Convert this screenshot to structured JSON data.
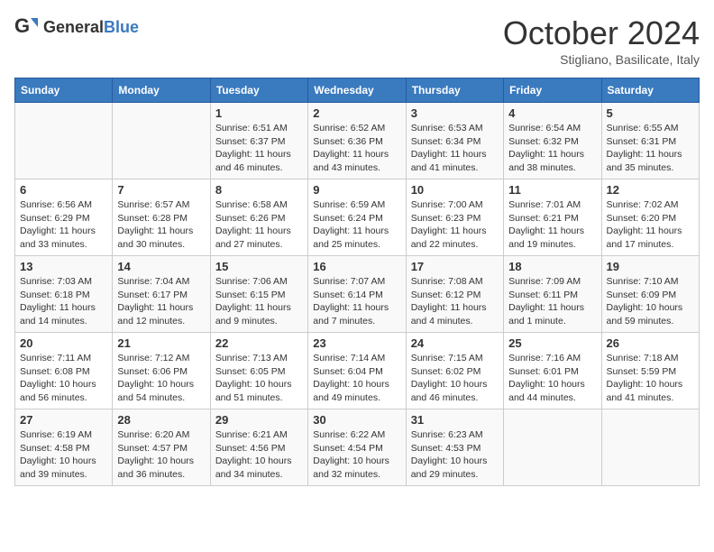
{
  "header": {
    "logo_general": "General",
    "logo_blue": "Blue",
    "month_title": "October 2024",
    "subtitle": "Stigliano, Basilicate, Italy"
  },
  "weekdays": [
    "Sunday",
    "Monday",
    "Tuesday",
    "Wednesday",
    "Thursday",
    "Friday",
    "Saturday"
  ],
  "weeks": [
    [
      null,
      null,
      {
        "day": 1,
        "sunrise": "6:51 AM",
        "sunset": "6:37 PM",
        "daylight": "11 hours and 46 minutes."
      },
      {
        "day": 2,
        "sunrise": "6:52 AM",
        "sunset": "6:36 PM",
        "daylight": "11 hours and 43 minutes."
      },
      {
        "day": 3,
        "sunrise": "6:53 AM",
        "sunset": "6:34 PM",
        "daylight": "11 hours and 41 minutes."
      },
      {
        "day": 4,
        "sunrise": "6:54 AM",
        "sunset": "6:32 PM",
        "daylight": "11 hours and 38 minutes."
      },
      {
        "day": 5,
        "sunrise": "6:55 AM",
        "sunset": "6:31 PM",
        "daylight": "11 hours and 35 minutes."
      }
    ],
    [
      {
        "day": 6,
        "sunrise": "6:56 AM",
        "sunset": "6:29 PM",
        "daylight": "11 hours and 33 minutes."
      },
      {
        "day": 7,
        "sunrise": "6:57 AM",
        "sunset": "6:28 PM",
        "daylight": "11 hours and 30 minutes."
      },
      {
        "day": 8,
        "sunrise": "6:58 AM",
        "sunset": "6:26 PM",
        "daylight": "11 hours and 27 minutes."
      },
      {
        "day": 9,
        "sunrise": "6:59 AM",
        "sunset": "6:24 PM",
        "daylight": "11 hours and 25 minutes."
      },
      {
        "day": 10,
        "sunrise": "7:00 AM",
        "sunset": "6:23 PM",
        "daylight": "11 hours and 22 minutes."
      },
      {
        "day": 11,
        "sunrise": "7:01 AM",
        "sunset": "6:21 PM",
        "daylight": "11 hours and 19 minutes."
      },
      {
        "day": 12,
        "sunrise": "7:02 AM",
        "sunset": "6:20 PM",
        "daylight": "11 hours and 17 minutes."
      }
    ],
    [
      {
        "day": 13,
        "sunrise": "7:03 AM",
        "sunset": "6:18 PM",
        "daylight": "11 hours and 14 minutes."
      },
      {
        "day": 14,
        "sunrise": "7:04 AM",
        "sunset": "6:17 PM",
        "daylight": "11 hours and 12 minutes."
      },
      {
        "day": 15,
        "sunrise": "7:06 AM",
        "sunset": "6:15 PM",
        "daylight": "11 hours and 9 minutes."
      },
      {
        "day": 16,
        "sunrise": "7:07 AM",
        "sunset": "6:14 PM",
        "daylight": "11 hours and 7 minutes."
      },
      {
        "day": 17,
        "sunrise": "7:08 AM",
        "sunset": "6:12 PM",
        "daylight": "11 hours and 4 minutes."
      },
      {
        "day": 18,
        "sunrise": "7:09 AM",
        "sunset": "6:11 PM",
        "daylight": "11 hours and 1 minute."
      },
      {
        "day": 19,
        "sunrise": "7:10 AM",
        "sunset": "6:09 PM",
        "daylight": "10 hours and 59 minutes."
      }
    ],
    [
      {
        "day": 20,
        "sunrise": "7:11 AM",
        "sunset": "6:08 PM",
        "daylight": "10 hours and 56 minutes."
      },
      {
        "day": 21,
        "sunrise": "7:12 AM",
        "sunset": "6:06 PM",
        "daylight": "10 hours and 54 minutes."
      },
      {
        "day": 22,
        "sunrise": "7:13 AM",
        "sunset": "6:05 PM",
        "daylight": "10 hours and 51 minutes."
      },
      {
        "day": 23,
        "sunrise": "7:14 AM",
        "sunset": "6:04 PM",
        "daylight": "10 hours and 49 minutes."
      },
      {
        "day": 24,
        "sunrise": "7:15 AM",
        "sunset": "6:02 PM",
        "daylight": "10 hours and 46 minutes."
      },
      {
        "day": 25,
        "sunrise": "7:16 AM",
        "sunset": "6:01 PM",
        "daylight": "10 hours and 44 minutes."
      },
      {
        "day": 26,
        "sunrise": "7:18 AM",
        "sunset": "5:59 PM",
        "daylight": "10 hours and 41 minutes."
      }
    ],
    [
      {
        "day": 27,
        "sunrise": "6:19 AM",
        "sunset": "4:58 PM",
        "daylight": "10 hours and 39 minutes."
      },
      {
        "day": 28,
        "sunrise": "6:20 AM",
        "sunset": "4:57 PM",
        "daylight": "10 hours and 36 minutes."
      },
      {
        "day": 29,
        "sunrise": "6:21 AM",
        "sunset": "4:56 PM",
        "daylight": "10 hours and 34 minutes."
      },
      {
        "day": 30,
        "sunrise": "6:22 AM",
        "sunset": "4:54 PM",
        "daylight": "10 hours and 32 minutes."
      },
      {
        "day": 31,
        "sunrise": "6:23 AM",
        "sunset": "4:53 PM",
        "daylight": "10 hours and 29 minutes."
      },
      null,
      null
    ]
  ]
}
